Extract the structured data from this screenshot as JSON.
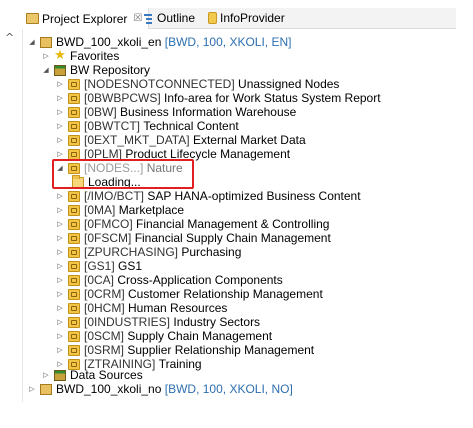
{
  "tabs": [
    {
      "label": "Project Explorer",
      "icon": "project-explorer-icon",
      "active": true,
      "close": "☒"
    },
    {
      "label": "Outline",
      "icon": "outline-icon",
      "active": false
    },
    {
      "label": "InfoProvider",
      "icon": "infoprovider-icon",
      "active": false
    }
  ],
  "gutter": {
    "collapse_glyph": "^"
  },
  "tree": {
    "project": {
      "name": "BWD_100_xkoli_en",
      "detail": "[BWD, 100, XKOLI, EN]"
    },
    "favorites": "Favorites",
    "repository": "BW Repository",
    "items": [
      {
        "tech": "[NODESNOTCONNECTED]",
        "desc": "Unassigned Nodes"
      },
      {
        "tech": "[0BWBPCWS]",
        "desc": "Info-area for Work Status System Report"
      },
      {
        "tech": "[0BW]",
        "desc": "Business Information Warehouse"
      },
      {
        "tech": "[0BWTCT]",
        "desc": "Technical Content"
      },
      {
        "tech": "[0EXT_MKT_DATA]",
        "desc": "External Market Data"
      },
      {
        "tech": "[0PLM]",
        "desc": "Product Lifecycle Management"
      }
    ],
    "expanded_item": {
      "tech": "[NODES...]",
      "desc": "Nature",
      "child": "Loading..."
    },
    "items_after": [
      {
        "tech": "[/IMO/BCT]",
        "desc": "SAP HANA-optimized Business Content"
      },
      {
        "tech": "[0MA]",
        "desc": "Marketplace"
      },
      {
        "tech": "[0FMCO]",
        "desc": "Financial Management & Controlling"
      },
      {
        "tech": "[0FSCM]",
        "desc": "Financial Supply Chain Management"
      },
      {
        "tech": "[ZPURCHASING]",
        "desc": "Purchasing"
      },
      {
        "tech": "[GS1]",
        "desc": "GS1"
      },
      {
        "tech": "[0CA]",
        "desc": "Cross-Application Components"
      },
      {
        "tech": "[0CRM]",
        "desc": "Customer Relationship Management"
      },
      {
        "tech": "[0HCM]",
        "desc": "Human Resources"
      },
      {
        "tech": "[0INDUSTRIES]",
        "desc": "Industry Sectors"
      },
      {
        "tech": "[0SCM]",
        "desc": "Supply Chain Management"
      },
      {
        "tech": "[0SRM]",
        "desc": "Supplier Relationship Management"
      },
      {
        "tech": "[ZTRAINING]",
        "desc": "Training"
      }
    ],
    "data_sources": "Data Sources",
    "project2": {
      "name": "BWD_100_xkoli_no",
      "detail": "[BWD, 100, XKOLI, NO]"
    }
  },
  "colors": {
    "highlight": "#e02020",
    "detail_text": "#2d6fb0"
  }
}
